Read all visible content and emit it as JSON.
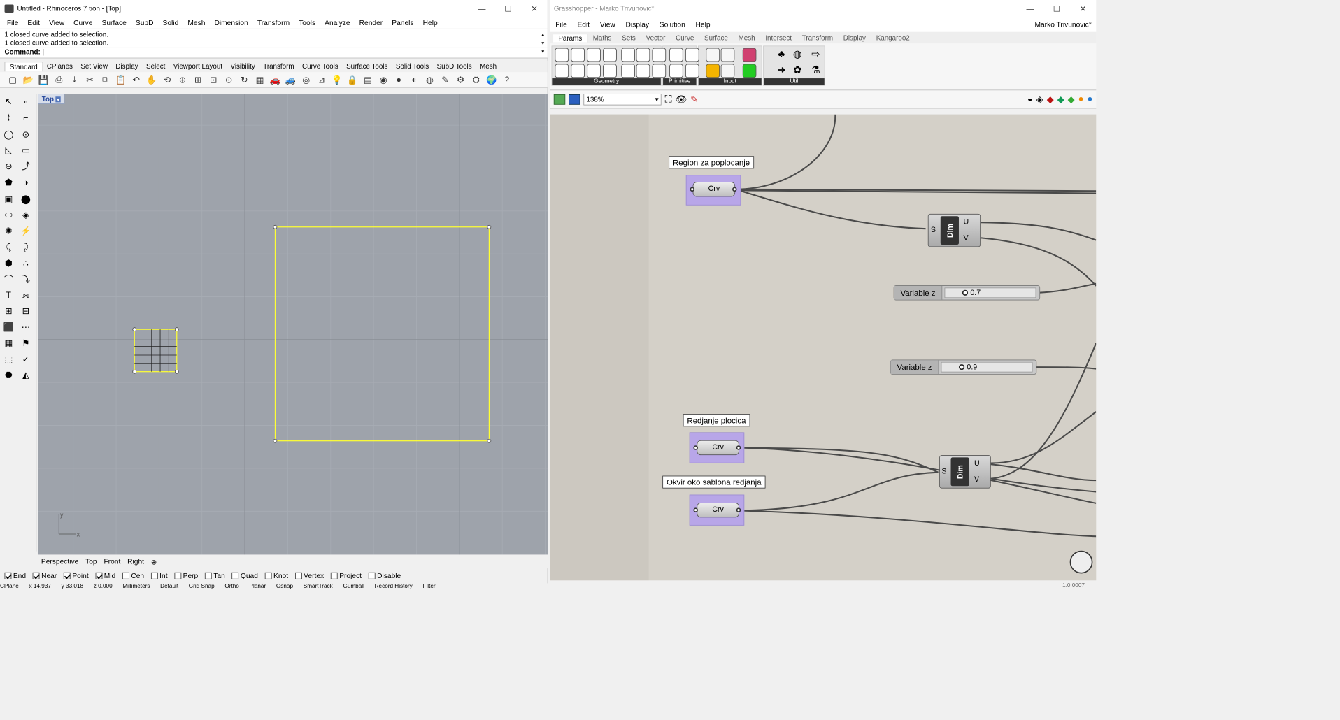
{
  "rhino": {
    "title": "Untitled - Rhinoceros 7 tion - [Top]",
    "menu": [
      "File",
      "Edit",
      "View",
      "Curve",
      "Surface",
      "SubD",
      "Solid",
      "Mesh",
      "Dimension",
      "Transform",
      "Tools",
      "Analyze",
      "Render",
      "Panels",
      "Help"
    ],
    "history": [
      "1 closed curve added to selection.",
      "1 closed curve added to selection."
    ],
    "command_label": "Command:",
    "toolbar_tabs": [
      "Standard",
      "CPlanes",
      "Set View",
      "Display",
      "Select",
      "Viewport Layout",
      "Visibility",
      "Transform",
      "Curve Tools",
      "Surface Tools",
      "Solid Tools",
      "SubD Tools",
      "Mesh"
    ],
    "toolbar_icons": [
      "new-icon",
      "open-icon",
      "save-icon",
      "print-icon",
      "import-icon",
      "cut-icon",
      "copy-icon",
      "paste-icon",
      "undo-icon",
      "pan-icon",
      "rotate-icon",
      "zoom-icon",
      "zoom-window-icon",
      "zoom-extents-icon",
      "zoom-selected-icon",
      "rotate-view-icon",
      "grid-icon",
      "car-icon",
      "car2-icon",
      "circle-icon",
      "cplane-icon",
      "bulb-icon",
      "lock-icon",
      "layer-icon",
      "color-wheel-icon",
      "sphere-icon",
      "shaded-icon",
      "render-sphere-icon",
      "pen-icon",
      "gear-icon",
      "options-icon",
      "globe-icon",
      "help-icon"
    ],
    "viewport_title": "Top",
    "viewport_tabs": [
      "Perspective",
      "Top",
      "Front",
      "Right"
    ],
    "osnaps": [
      {
        "label": "End",
        "on": true
      },
      {
        "label": "Near",
        "on": true
      },
      {
        "label": "Point",
        "on": true
      },
      {
        "label": "Mid",
        "on": true
      },
      {
        "label": "Cen",
        "on": false
      },
      {
        "label": "Int",
        "on": false
      },
      {
        "label": "Perp",
        "on": false
      },
      {
        "label": "Tan",
        "on": false
      },
      {
        "label": "Quad",
        "on": false
      },
      {
        "label": "Knot",
        "on": false
      },
      {
        "label": "Vertex",
        "on": false
      },
      {
        "label": "Project",
        "on": false
      },
      {
        "label": "Disable",
        "on": false
      }
    ],
    "axis_x": "x",
    "axis_y": "y",
    "status": [
      "CPlane",
      "x 14.937",
      "y 33.018",
      "z 0.000",
      "Millimeters",
      "Default",
      "Grid Snap",
      "Ortho",
      "Planar",
      "Osnap",
      "SmartTrack",
      "Gumball",
      "Record History",
      "Filter"
    ]
  },
  "gh": {
    "title": "Grasshopper - Marko Trivunovic*",
    "menu": [
      "File",
      "Edit",
      "View",
      "Display",
      "Solution",
      "Help"
    ],
    "user": "Marko Trivunovic*",
    "tabs": [
      "Params",
      "Maths",
      "Sets",
      "Vector",
      "Curve",
      "Surface",
      "Mesh",
      "Intersect",
      "Transform",
      "Display",
      "Kangaroo2"
    ],
    "groups": [
      "Geometry",
      "Primitive",
      "Input",
      "Util"
    ],
    "zoom": "138%",
    "components": {
      "region_label": "Region za poplocanje",
      "crv": "Crv",
      "redjanje_label": "Redjanje plocica",
      "okvir_label": "Okvir oko sablona redjanja",
      "dim": "Dim",
      "s": "S",
      "u": "U",
      "v": "V"
    },
    "sliders": [
      {
        "label": "Variable z",
        "value": "0.7"
      },
      {
        "label": "Variable z",
        "value": "0.9"
      }
    ],
    "footer": "1.0.0007"
  }
}
